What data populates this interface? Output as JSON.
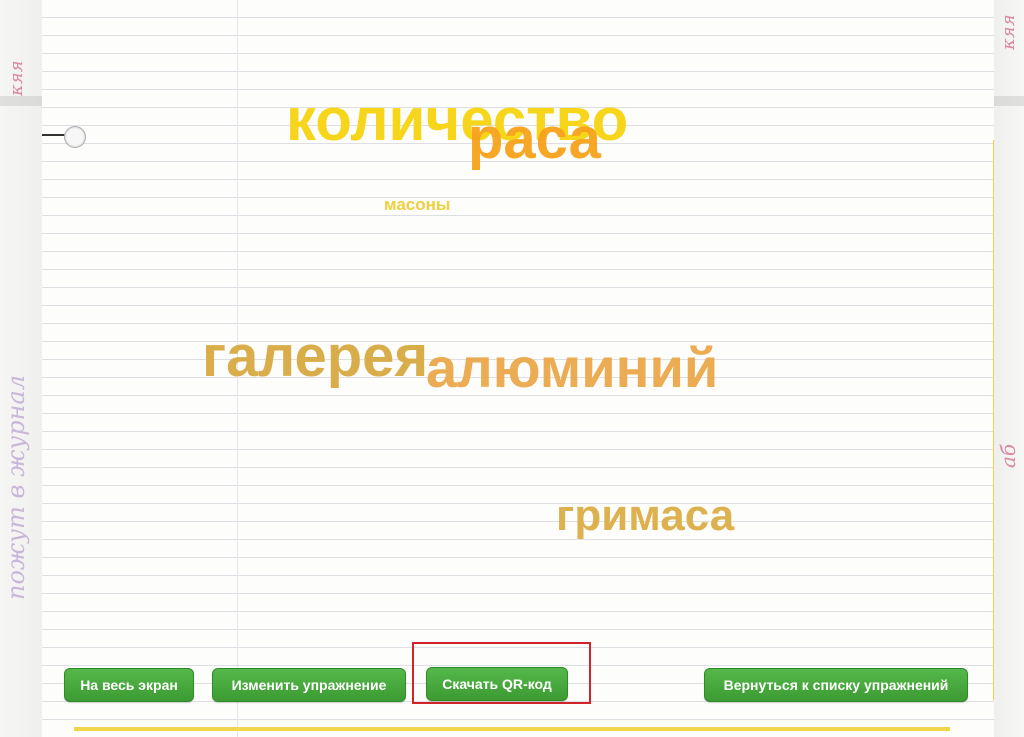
{
  "words": {
    "kolichestvo": "количество",
    "rasa": "раса",
    "masony": "масоны",
    "galereya": "галерея",
    "alyuminiy": "алюминий",
    "grimasa": "гримаса"
  },
  "buttons": {
    "fullscreen": "На весь экран",
    "edit": "Изменить упражнение",
    "download_qr": "Скачать QR-код",
    "back_to_list": "Вернуться к списку упражнений"
  },
  "colors": {
    "button_green": "#3c9b33",
    "highlight_red": "#d2232a",
    "word_yellow": "#f6d51b",
    "word_orange": "#f7a21b"
  }
}
